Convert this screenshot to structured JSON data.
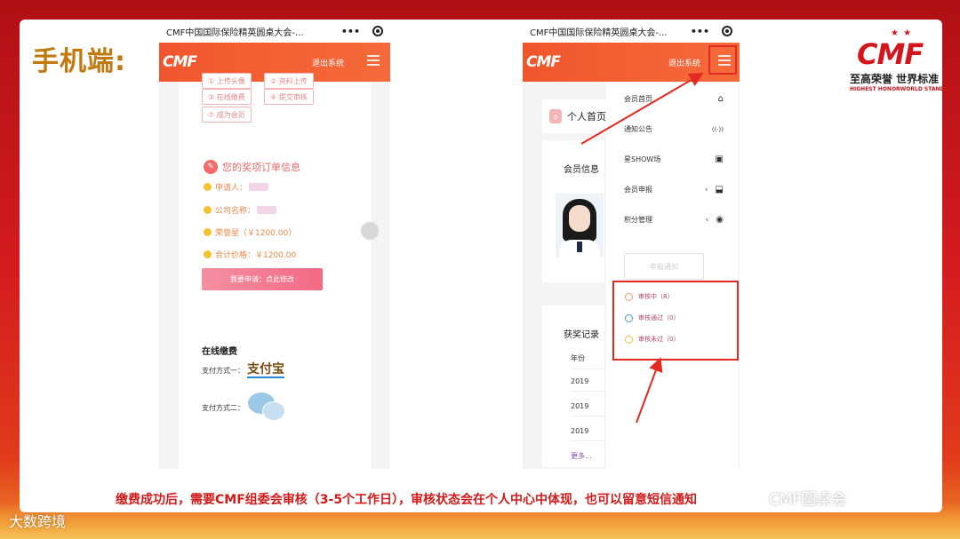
{
  "slide": {
    "heading": "手机端:",
    "caption": "缴费成功后，需要CMF组委会审核（3-5个工作日），审核状态会在个人中心中体现，也可以留意短信通知",
    "watermark_right": "CMF圆桌会",
    "watermark_left": "大数跨境"
  },
  "brand": {
    "stars": "★ ★",
    "mark": "CMF",
    "cn": "至高荣誉  世界标准",
    "en_left": "HIGHEST HONOR",
    "en_right": "WORLD STANDARD"
  },
  "left_phone": {
    "title": "CMF中国国际保险精英圆桌大会-...",
    "more": "•••",
    "logo": "CMF",
    "logout": "退出系统",
    "steps": [
      "① 上传头像",
      "② 资料上传",
      "③ 在线缴费",
      "④ 提交审核",
      "⑦ 成为会员"
    ],
    "order_title": "您的奖项订单信息",
    "applicant_label": "申请人：",
    "company_label": "公司名称：",
    "award_label": "荣誉星（￥1200.00）",
    "total_label": "合计价格：￥1200.00",
    "pay_button": "我要申请：点此修改",
    "online_pay": "在线缴费",
    "pay_way_1": "支付方式一：",
    "alipay": "支付宝",
    "pay_way_2": "支付方式二："
  },
  "right_phone": {
    "title": "CMF中国国际保险精英圆桌大会-...",
    "more": "•••",
    "logo": "CMF",
    "logout": "退出系统",
    "home": "个人首页",
    "member_info": "会员信息",
    "award_records": "获奖记录",
    "year_header": "年份",
    "years": [
      "2019",
      "2019",
      "2019"
    ],
    "more_link": "更多...",
    "apply_button": "申报通知",
    "drawer": [
      {
        "label": "会员首页",
        "icon": "⌂"
      },
      {
        "label": "通知公告",
        "icon": "((·))"
      },
      {
        "label": "星SHOW场",
        "icon": "▣"
      },
      {
        "label": "会员申报",
        "icon": "⬓"
      },
      {
        "label": "积分管理",
        "icon": "◉"
      }
    ],
    "status": [
      {
        "label": "审核中（8）",
        "color": "#e8a080"
      },
      {
        "label": "审核通过（0）",
        "color": "#4aa0c8"
      },
      {
        "label": "审核未过（0）",
        "color": "#e8c840"
      }
    ]
  }
}
